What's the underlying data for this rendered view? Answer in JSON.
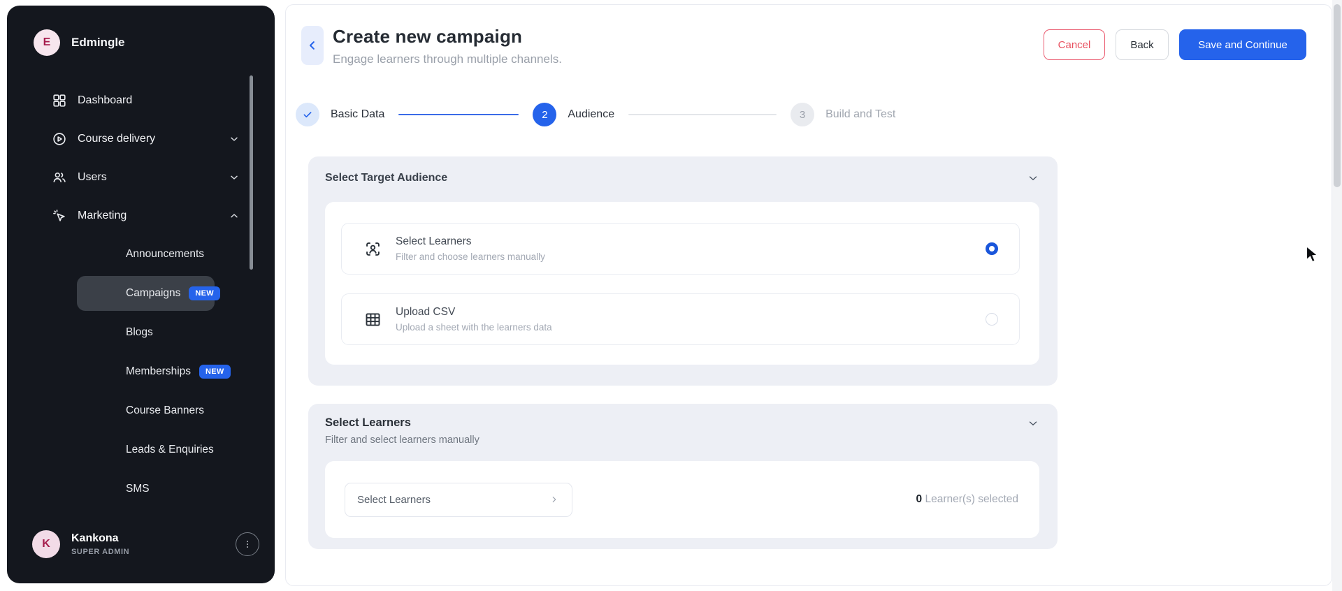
{
  "sidebar": {
    "brand": {
      "initial": "E",
      "name": "Edmingle"
    },
    "items": [
      {
        "label": "Dashboard"
      },
      {
        "label": "Course delivery"
      },
      {
        "label": "Users"
      },
      {
        "label": "Marketing"
      }
    ],
    "subitems": [
      {
        "label": "Announcements"
      },
      {
        "label": "Campaigns",
        "badge": "NEW"
      },
      {
        "label": "Blogs"
      },
      {
        "label": "Memberships",
        "badge": "NEW"
      },
      {
        "label": "Course Banners"
      },
      {
        "label": "Leads & Enquiries"
      },
      {
        "label": "SMS"
      }
    ],
    "user": {
      "initial": "K",
      "name": "Kankona",
      "role": "SUPER ADMIN"
    }
  },
  "header": {
    "title": "Create new campaign",
    "subtitle": "Engage learners through multiple channels.",
    "cancel_label": "Cancel",
    "back_label": "Back",
    "save_label": "Save and Continue"
  },
  "stepper": {
    "steps": [
      {
        "label": "Basic Data",
        "state": "complete"
      },
      {
        "number": "2",
        "label": "Audience",
        "state": "active"
      },
      {
        "number": "3",
        "label": "Build and Test",
        "state": "upcoming"
      }
    ]
  },
  "audience_section": {
    "title": "Select Target Audience",
    "options": [
      {
        "title": "Select Learners",
        "subtitle": "Filter and choose learners manually",
        "selected": true
      },
      {
        "title": "Upload CSV",
        "subtitle": "Upload a sheet with the learners data",
        "selected": false
      }
    ]
  },
  "learners_section": {
    "title": "Select Learners",
    "subtitle": "Filter and select learners manually",
    "dropdown_label": "Select Learners",
    "selected_count": "0",
    "selected_suffix": " Learner(s) selected"
  },
  "colors": {
    "accent": "#2563eb",
    "danger": "#e8505f",
    "sidebar_bg": "#14171e",
    "panel_bg": "#edeff5"
  }
}
